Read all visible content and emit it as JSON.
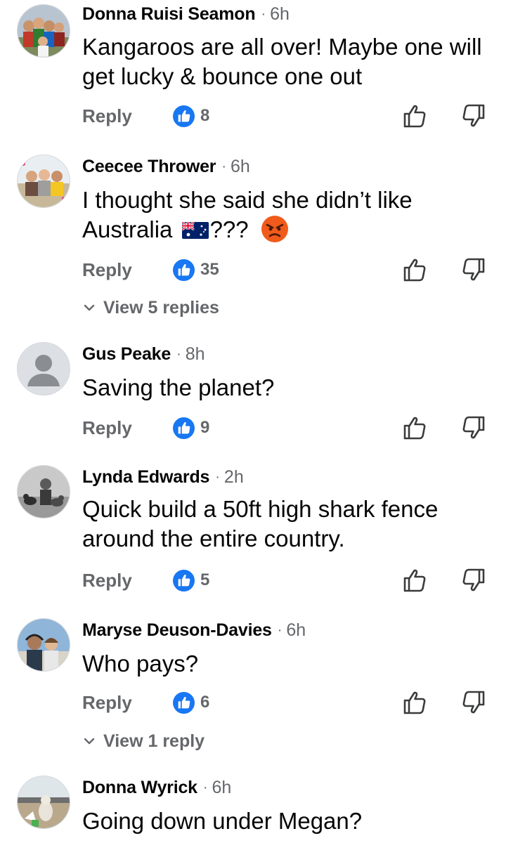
{
  "comments": [
    {
      "name": "Donna Ruisi Seamon",
      "time": "6h",
      "text": "Kangaroos are all over! Maybe one will get lucky & bounce one out",
      "reply_label": "Reply",
      "likes": "8"
    },
    {
      "name": "Ceecee Thrower",
      "time": "6h",
      "text_before": "I thought she said she didn’t like Australia ",
      "text_after": "??? ",
      "reply_label": "Reply",
      "likes": "35",
      "view_replies": "View 5 replies",
      "emojis": [
        "australia-flag",
        "angry-face"
      ]
    },
    {
      "name": "Gus Peake",
      "time": "8h",
      "text": "Saving the planet?",
      "reply_label": "Reply",
      "likes": "9"
    },
    {
      "name": "Lynda Edwards",
      "time": "2h",
      "text": "Quick build a 50ft high shark fence around the entire country.",
      "reply_label": "Reply",
      "likes": "5"
    },
    {
      "name": "Maryse Deuson-Davies",
      "time": "6h",
      "text": "Who pays?",
      "reply_label": "Reply",
      "likes": "6",
      "view_replies": "View 1 reply"
    },
    {
      "name": "Donna Wyrick",
      "time": "6h",
      "text": "Going down under Megan?"
    }
  ],
  "separator": "·",
  "colors": {
    "like_blue": "#1877f2",
    "secondary_text": "#65676b",
    "primary_text": "#050505"
  },
  "icons": {
    "like": "thumbs-up-icon",
    "upvote": "upvote-outline-icon",
    "downvote": "downvote-outline-icon",
    "chevron": "chevron-down-icon",
    "default_avatar": "person-silhouette-icon"
  }
}
